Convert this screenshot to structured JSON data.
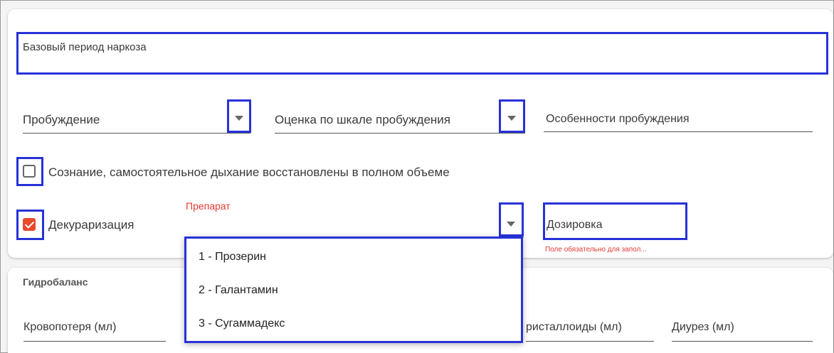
{
  "anesthesia_card": {
    "base_period_field": {
      "label": "Базовый период наркоза"
    },
    "awakening_select": {
      "label": "Пробуждение"
    },
    "awakening_scale_select": {
      "label": "Оценка по шкале пробуждения"
    },
    "awakening_features_field": {
      "label": "Особенности пробуждения"
    },
    "consciousness_checkbox": {
      "label": "Сознание, самостоятельное дыхание восстановлены в полном объеме",
      "checked": false
    },
    "decurarization_checkbox": {
      "label": "Декураризация",
      "checked": true
    },
    "drug_select": {
      "label": "Препарат"
    },
    "dosage_field": {
      "label": "Дозировка",
      "error": "Поле обязательно для запол..."
    }
  },
  "drug_dropdown": {
    "options": [
      "1 - Прозерин",
      "2 - Галантамин",
      "3 - Сугаммадекс"
    ]
  },
  "hydrobalance_card": {
    "title": "Гидробаланс",
    "blood_loss_field": {
      "label": "Кровопотеря (мл)"
    },
    "crystalloids_field": {
      "label": "ристаллоиды (мл)"
    },
    "diuresis_field": {
      "label": "Диурез (мл)"
    }
  },
  "colors": {
    "highlight": "#2632d8",
    "error": "#e53935",
    "checkbox_checked": "#e84a2e"
  }
}
